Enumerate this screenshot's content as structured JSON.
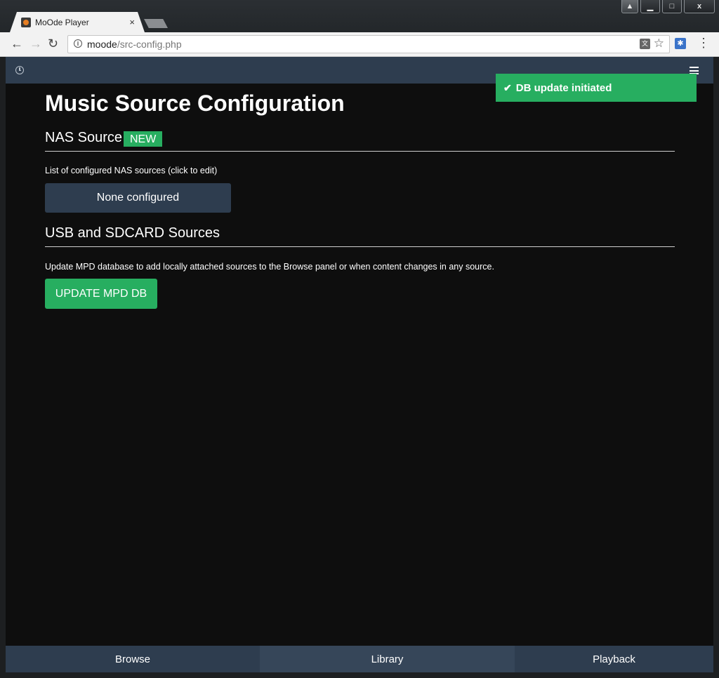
{
  "browser": {
    "tab_title": "MoOde Player",
    "tab_close": "×",
    "url_host": "moode",
    "url_path": "/src-config.php",
    "window_controls": {
      "minimize": "▁",
      "maximize": "□",
      "close": "x"
    },
    "icons": [
      "back-arrow-icon",
      "forward-arrow-icon",
      "reload-icon",
      "info-icon",
      "translate-icon",
      "star-icon",
      "extension-icon",
      "menu-dots-icon"
    ]
  },
  "app": {
    "header_icons": [
      "clock-icon",
      "hamburger-icon"
    ],
    "toast": {
      "check": "✔",
      "text": "DB update initiated"
    },
    "page_title": "Music Source Configuration",
    "nas": {
      "title": "NAS Source",
      "badge": "NEW",
      "help": "List of configured NAS sources (click to edit)",
      "list_button": "None configured"
    },
    "usb": {
      "title": "USB and SDCARD Sources",
      "help": "Update MPD database to add locally attached sources to the Browse panel or when content changes in any source.",
      "update_button": "UPDATE MPD DB"
    },
    "bottom_nav": {
      "browse": "Browse",
      "library": "Library",
      "playback": "Playback"
    }
  },
  "colors": {
    "header_bg": "#2e3d4f",
    "page_bg": "#0e0e0e",
    "accent_green": "#27ae60"
  }
}
